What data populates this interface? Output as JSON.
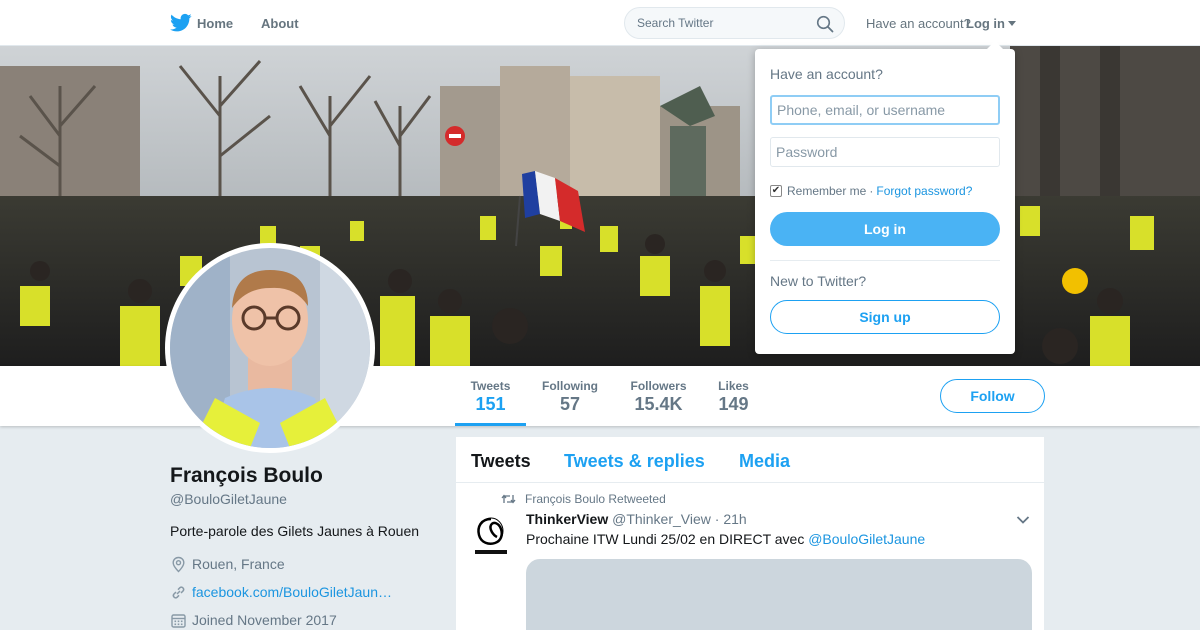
{
  "nav": {
    "logo_icon": "twitter-bird-icon",
    "home_label": "Home",
    "about_label": "About",
    "search_placeholder": "Search Twitter",
    "have_account_label": "Have an account?",
    "login_label": "Log in"
  },
  "profile": {
    "name": "François Boulo",
    "handle": "@BouloGiletJaune",
    "bio": "Porte-parole des Gilets Jaunes à Rouen",
    "location": "Rouen, France",
    "website": "facebook.com/BouloGiletJaun…",
    "joined": "Joined November 2017",
    "follow_label": "Follow"
  },
  "stats": [
    {
      "label": "Tweets",
      "value": "151",
      "active": true
    },
    {
      "label": "Following",
      "value": "57"
    },
    {
      "label": "Followers",
      "value": "15.4K"
    },
    {
      "label": "Likes",
      "value": "149"
    }
  ],
  "timeline": {
    "tabs": [
      "Tweets",
      "Tweets & replies",
      "Media"
    ],
    "active_tab": "Tweets"
  },
  "tweet": {
    "retweet_context": "François Boulo Retweeted",
    "author": "ThinkerView",
    "handle": "@Thinker_View",
    "separator": "·",
    "time": "21h",
    "text": "Prochaine ITW Lundi 25/02 en DIRECT avec",
    "mention": "@BouloGiletJaune"
  },
  "login_dropdown": {
    "title": "Have an account?",
    "username_placeholder": "Phone, email, or username",
    "password_placeholder": "Password",
    "remember_label": "Remember me",
    "separator": "·",
    "forgot_label": "Forgot password?",
    "login_button": "Log in",
    "new_label": "New to Twitter?",
    "signup_button": "Sign up"
  },
  "colors": {
    "accent": "#1da1f2",
    "login_button": "#4ab3f4",
    "background": "#e6ecf0",
    "muted_text": "#657786"
  }
}
